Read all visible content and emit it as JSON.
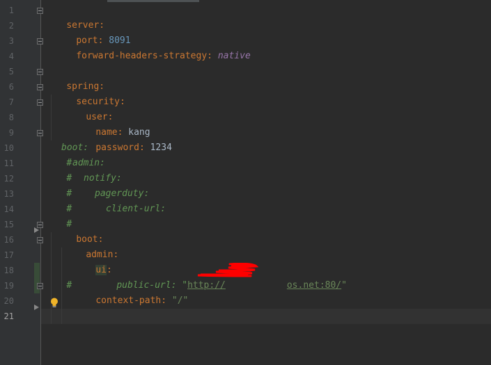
{
  "editor": {
    "language": "yaml",
    "colors": {
      "background": "#2b2b2b",
      "gutter": "#313335",
      "key": "#cc7832",
      "number": "#6897bb",
      "comment": "#629755",
      "string": "#6a8759",
      "keyword": "#9876aa"
    },
    "active_line": "21",
    "lines": [
      {
        "n": "1",
        "key": "server",
        "sep": ":"
      },
      {
        "n": "2",
        "key": "port",
        "sep": ": ",
        "val": "8091"
      },
      {
        "n": "3",
        "key": "forward-headers-strategy",
        "sep": ": ",
        "val": "native"
      },
      {
        "n": "4"
      },
      {
        "n": "5",
        "key": "spring",
        "sep": ":"
      },
      {
        "n": "6",
        "key": "security",
        "sep": ":"
      },
      {
        "n": "7",
        "key": "user",
        "sep": ":"
      },
      {
        "n": "8",
        "key": "name",
        "sep": ": ",
        "val": "kang"
      },
      {
        "n": "9",
        "key": "password",
        "sep": ": ",
        "val": "1234"
      },
      {
        "n": "10",
        "hash": "#",
        "text": "boot:"
      },
      {
        "n": "11",
        "hash": "#",
        "text": "admin:"
      },
      {
        "n": "12",
        "hash": "#",
        "text": "notify:"
      },
      {
        "n": "13",
        "hash": "#",
        "text": "pagerduty:"
      },
      {
        "n": "14",
        "hash": "#",
        "text": "client-url:"
      },
      {
        "n": "15",
        "key": "boot",
        "sep": ":"
      },
      {
        "n": "16",
        "key": "admin",
        "sep": ":"
      },
      {
        "n": "17",
        "key": "ui",
        "sep": ":"
      },
      {
        "n": "18",
        "hash": "#",
        "text": "public-url: \"",
        "url_start": "http://",
        "url_end": "os.net:80/",
        "text_end": "\""
      },
      {
        "n": "19",
        "key": "context-path",
        "sep": ": ",
        "val": "\"/\""
      },
      {
        "n": "20"
      },
      {
        "n": "21"
      }
    ],
    "icons": [
      "fold-open-icon",
      "fold-close-icon",
      "run-arrow-icon",
      "lightbulb-icon"
    ]
  }
}
